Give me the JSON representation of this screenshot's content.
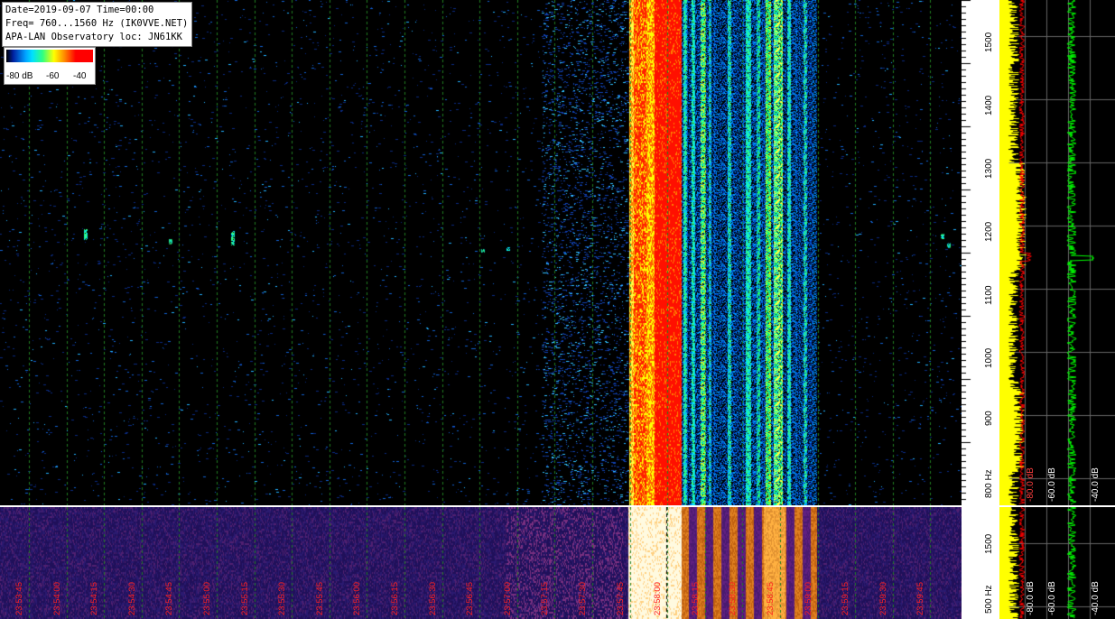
{
  "header": {
    "line1": "Date=2019-09-07 Time=00:00",
    "line2": "Freq= 760...1560 Hz (IK0VVE.NET)",
    "line3": "APA-LAN Observatory loc: JN61KK"
  },
  "colorbar": {
    "labels": [
      "-80 dB",
      "-60",
      "-40"
    ]
  },
  "freq_axis": {
    "ticks": [
      "800 Hz",
      "900",
      "1000",
      "1100",
      "1200",
      "1300",
      "1400",
      "1500"
    ]
  },
  "lower_freq_axis": {
    "ticks": [
      "500 Hz",
      "1500"
    ]
  },
  "spectrum_db_labels": [
    "-60.0 dB",
    "-40.0 dB"
  ],
  "spectrum_db_labels_top": [
    "-80.0 dB"
  ],
  "lower_db_labels": [
    "-80.0 dB",
    "-60.0 dB",
    "-40.0 dB"
  ],
  "time_labels": [
    "23:53:45",
    "23:54:00",
    "23:54:15",
    "23:54:30",
    "23:54:45",
    "23:55:00",
    "23:55:15",
    "23:55:30",
    "23:55:45",
    "23:56:00",
    "23:56:15",
    "23:56:30",
    "23:56:45",
    "23:57:00",
    "23:57:15",
    "23:57:30",
    "23:57:45",
    "23:58:00",
    "23:58:15",
    "23:58:30",
    "23:58:45",
    "23:59:00",
    "23:59:15",
    "23:59:30",
    "23:59:45"
  ],
  "colors": {
    "trace_max": "#ffff00",
    "trace_peak": "#ff0000",
    "trace_avg": "#00ff00",
    "time_label": "#ff2020",
    "grid": "#208020"
  }
}
